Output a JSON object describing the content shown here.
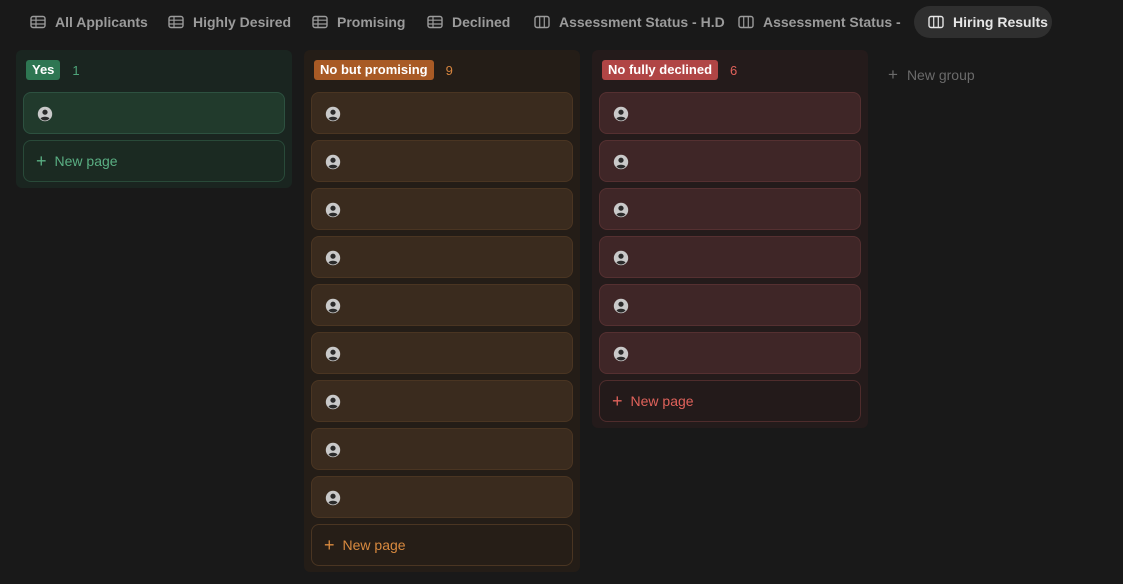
{
  "tabs": [
    {
      "label": "All Applicants",
      "icon": "table-icon",
      "active": false
    },
    {
      "label": "Highly Desired",
      "icon": "table-icon",
      "active": false
    },
    {
      "label": "Promising",
      "icon": "table-icon",
      "active": false
    },
    {
      "label": "Declined",
      "icon": "table-icon",
      "active": false
    },
    {
      "label": "Assessment Status - H.D",
      "icon": "board-icon",
      "active": false
    },
    {
      "label": "Assessment Status - P",
      "icon": "board-icon",
      "active": false
    },
    {
      "label": "Hiring Results",
      "icon": "board-icon",
      "active": true
    }
  ],
  "groups": [
    {
      "label": "Yes",
      "count": "1",
      "cards": 1,
      "color": "#2e7652",
      "new_page_label": "New page"
    },
    {
      "label": "No but promising",
      "count": "9",
      "cards": 9,
      "color": "#a85a25",
      "new_page_label": "New page"
    },
    {
      "label": "No fully declined",
      "count": "6",
      "cards": 6,
      "color": "#b04545",
      "new_page_label": "New page"
    }
  ],
  "new_group_label": "New group",
  "card_icon": "person-icon"
}
